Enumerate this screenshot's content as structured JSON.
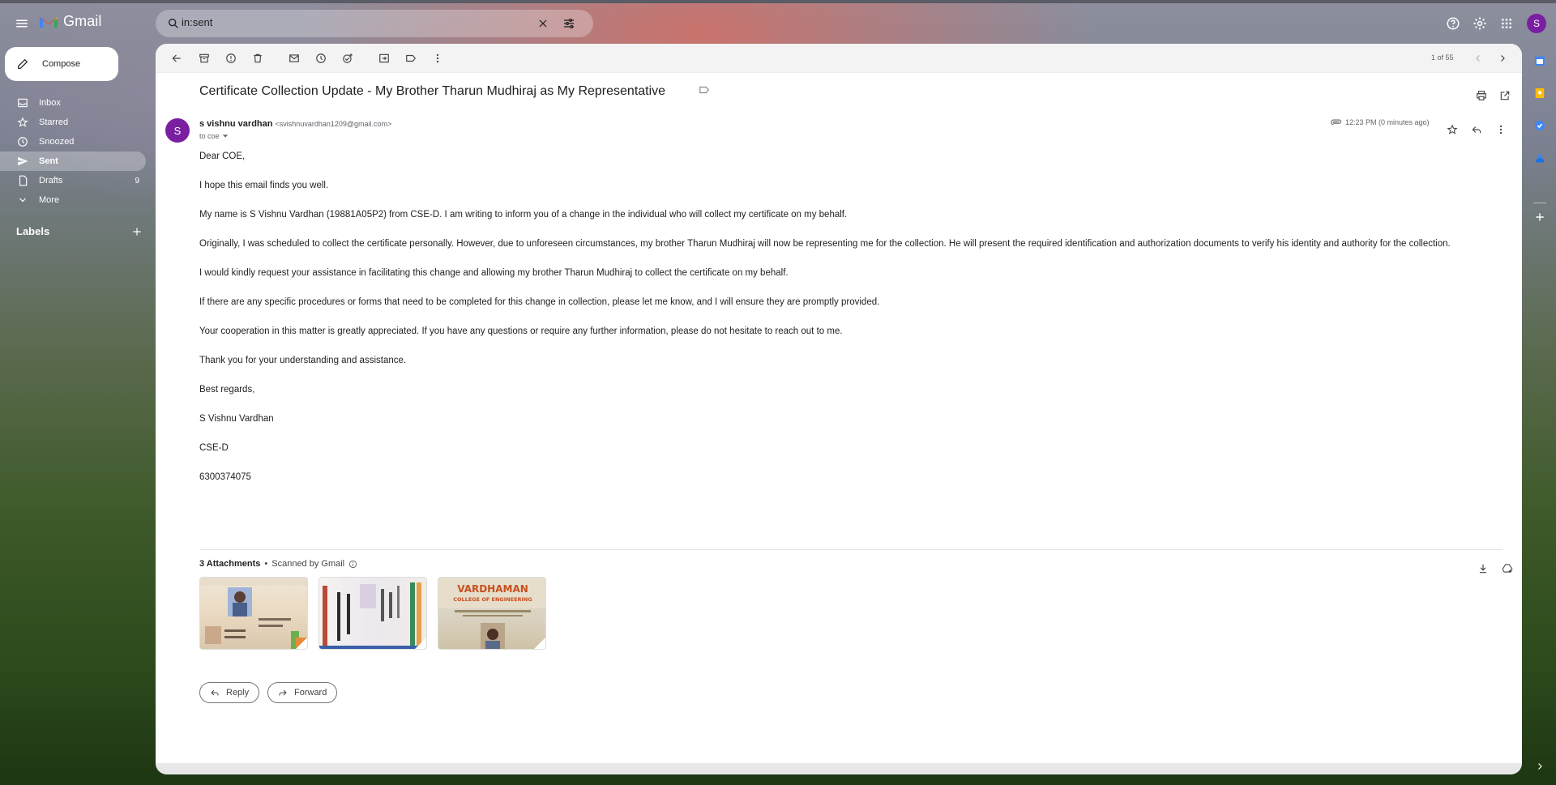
{
  "app": {
    "name": "Gmail"
  },
  "search": {
    "value": "in:sent"
  },
  "compose_label": "Compose",
  "nav": [
    {
      "label": "Inbox",
      "icon": "inbox-icon",
      "count": ""
    },
    {
      "label": "Starred",
      "icon": "star-icon",
      "count": ""
    },
    {
      "label": "Snoozed",
      "icon": "clock-icon",
      "count": ""
    },
    {
      "label": "Sent",
      "icon": "send-icon",
      "count": "",
      "active": true
    },
    {
      "label": "Drafts",
      "icon": "draft-icon",
      "count": "9"
    },
    {
      "label": "More",
      "icon": "chevron-down-icon",
      "count": ""
    }
  ],
  "labels_heading": "Labels",
  "pager": {
    "text": "1 of 55"
  },
  "avatar_letter": "S",
  "email": {
    "subject": "Certificate Collection Update - My Brother Tharun Mudhiraj as My Representative",
    "sender_name": "s vishnu vardhan",
    "sender_email": "<svishnuvardhan1209@gmail.com>",
    "to": "to coe",
    "time": "12:23 PM (0 minutes ago)",
    "avatar_letter": "S",
    "body": [
      "Dear COE,",
      "I hope this email finds you well.",
      "My name is S Vishnu Vardhan (19881A05P2) from CSE-D. I am writing to inform you of a change in the individual who will collect my certificate on my behalf.",
      "Originally, I was scheduled to collect the certificate personally. However, due to unforeseen circumstances, my brother Tharun Mudhiraj will now be representing me for the collection. He will present the required identification and authorization documents to verify his identity and authority for the collection.",
      "I would kindly request your assistance in facilitating this change and allowing my brother Tharun Mudhiraj to collect the certificate on my behalf.",
      "If there are any specific procedures or forms that need to be completed for this change in collection, please let me know, and I will ensure they are promptly provided.",
      "Your cooperation in this matter is greatly appreciated. If you have any questions or require any further information, please do not hesitate to reach out to me.",
      "Thank you for your understanding and assistance.",
      "Best regards,",
      "S Vishnu Vardhan",
      "CSE-D",
      "6300374075"
    ]
  },
  "attachments": {
    "heading": "3 Attachments",
    "separator": "•",
    "scanned": "Scanned by Gmail",
    "thumb3_text": "VARDHAMAN",
    "thumb3_sub": "COLLEGE OF ENGINEERING"
  },
  "actions": {
    "reply": "Reply",
    "forward": "Forward"
  },
  "colors": {
    "avatar": "#7b1fa2",
    "gmail_red": "#ea4335",
    "panel_bg": "#ffffff"
  }
}
